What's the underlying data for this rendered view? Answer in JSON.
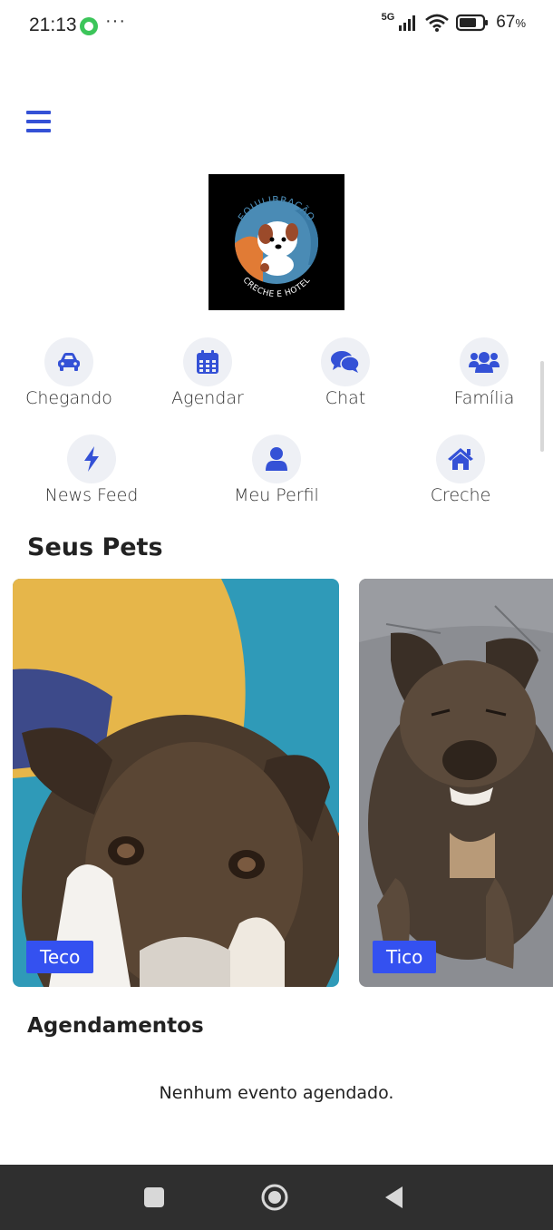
{
  "status_bar": {
    "time": "21:13",
    "dots": "···",
    "network": "5G",
    "battery": "67",
    "battery_unit": "%"
  },
  "logo": {
    "top_text": "EQUILIBRAÇÃO",
    "bottom_text": "CRECHE E HOTEL"
  },
  "quick_actions": [
    {
      "label": "Chegando",
      "icon": "car-icon"
    },
    {
      "label": "Agendar",
      "icon": "calendar-icon"
    },
    {
      "label": "Chat",
      "icon": "chat-icon"
    },
    {
      "label": "Família",
      "icon": "family-icon"
    },
    {
      "label": "News Feed",
      "icon": "bolt-icon"
    },
    {
      "label": "Meu Perfil",
      "icon": "user-icon"
    },
    {
      "label": "Creche",
      "icon": "home-icon"
    }
  ],
  "pets_section": {
    "title": "Seus Pets",
    "pets": [
      {
        "name": "Teco"
      },
      {
        "name": "Tico"
      }
    ]
  },
  "appointments": {
    "title": "Agendamentos",
    "empty_text": "Nenhum evento agendado."
  },
  "colors": {
    "accent": "#3451d6",
    "badge": "#3451f0",
    "icon_bg": "#eef0f5",
    "nav_bar": "#2f2f2f"
  }
}
